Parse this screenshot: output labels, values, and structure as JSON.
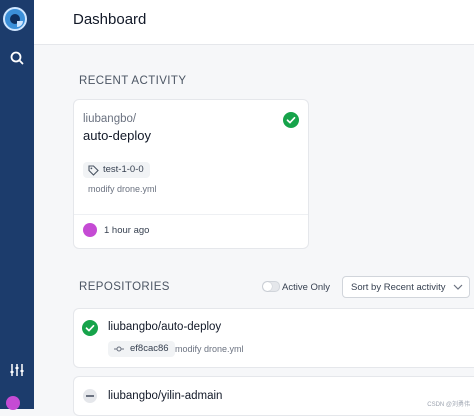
{
  "header": {
    "title": "Dashboard"
  },
  "recent_activity": {
    "section_title": "RECENT ACTIVITY",
    "card": {
      "owner": "liubangbo/",
      "repo": "auto-deploy",
      "status_icon": "check-circle-icon",
      "tag": "test-1-0-0",
      "message": "modify drone.yml",
      "time": "1 hour ago"
    }
  },
  "repositories": {
    "section_title": "REPOSITORIES",
    "active_only_label": "Active Only",
    "sort_label": "Sort by Recent activity",
    "items": [
      {
        "name": "liubangbo/auto-deploy",
        "commit": "ef8cac86",
        "message": "modify drone.yml",
        "status_icon": "check-circle-icon"
      },
      {
        "name": "liubangbo/yilin-admain",
        "status_icon": "pending-icon"
      }
    ]
  },
  "watermark": "CSDN @刘勇伟",
  "colors": {
    "sidebar": "#1c3c6c",
    "success": "#16a34a",
    "avatar": "#c54bd4"
  }
}
